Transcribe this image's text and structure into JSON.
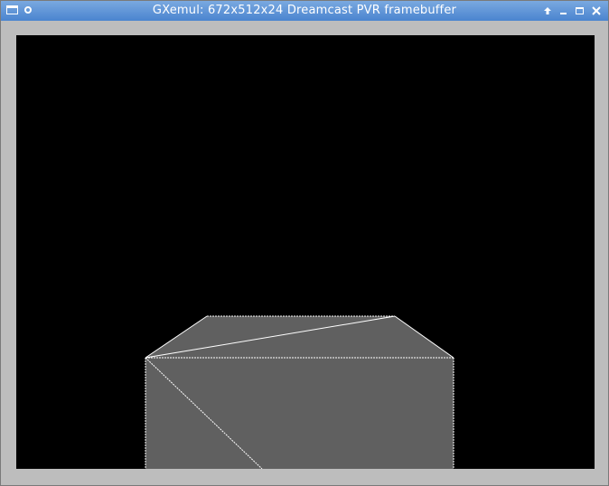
{
  "window": {
    "title": "GXemul: 672x512x24 Dreamcast PVR framebuffer",
    "titlebar_color": "#5a93d6",
    "frame_color": "#bdbdbd"
  },
  "titlebar_buttons": {
    "menu_icon": "window-menu-icon",
    "sticky_icon": "sticky-icon",
    "shade_icon": "shade-icon",
    "minimize_icon": "minimize-icon",
    "maximize_icon": "maximize-icon",
    "close_icon": "close-icon"
  },
  "framebuffer": {
    "background": "#000000",
    "polygon_fill": "#606060",
    "edge_color": "#ffffff",
    "scene": "wireframe-shaded box (top and front faces)"
  }
}
